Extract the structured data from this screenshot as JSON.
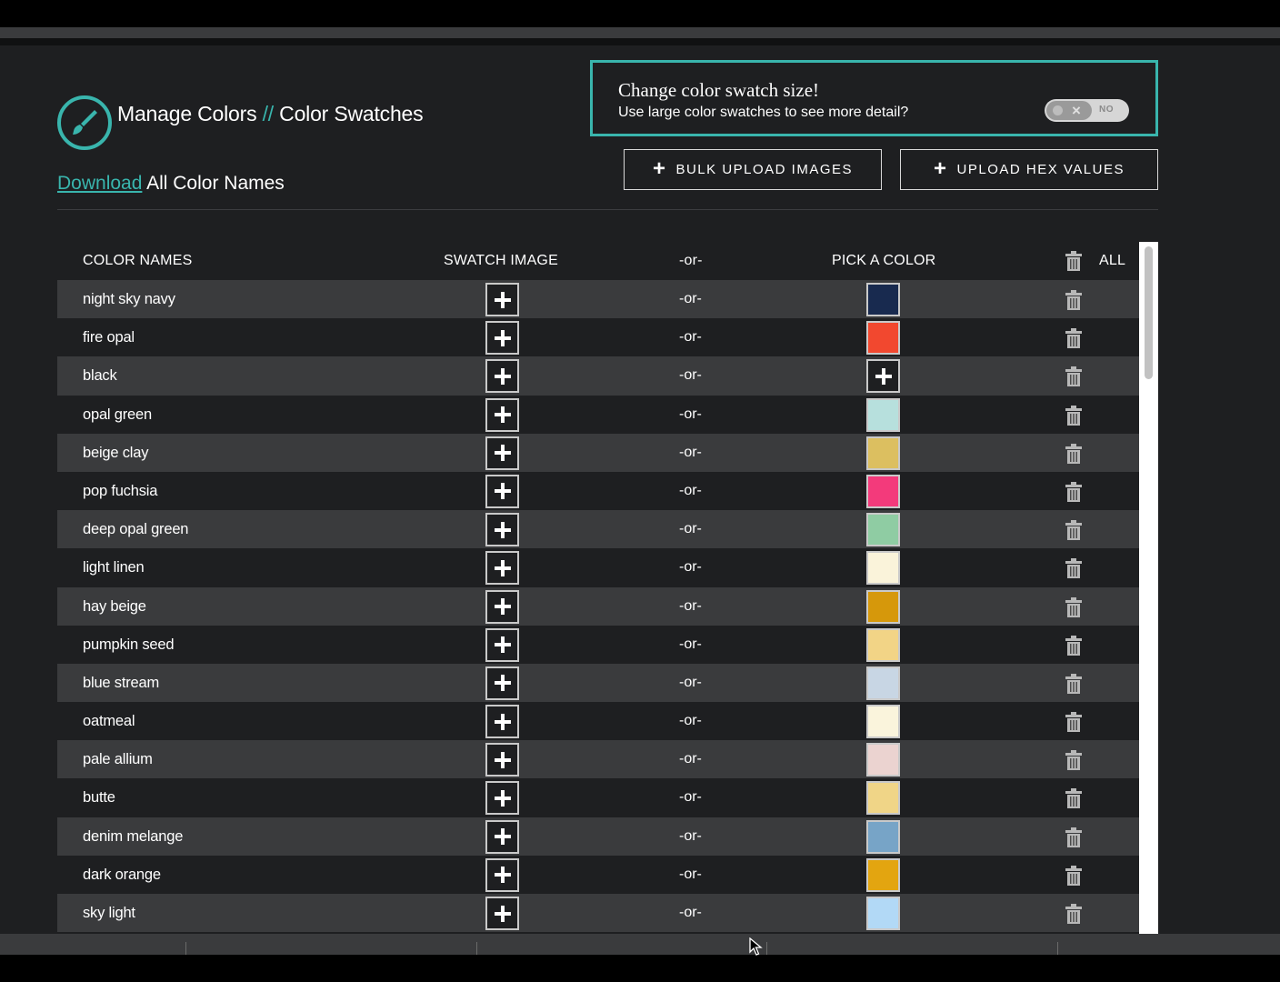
{
  "header": {
    "title_part1": "Manage Colors",
    "title_sep": "//",
    "title_part2": "Color Swatches",
    "download_link": "Download",
    "download_suffix": "All Color Names",
    "icon": "paintbrush-icon"
  },
  "size_panel": {
    "heading": "Change color swatch size!",
    "description": "Use large color swatches to see more detail?",
    "toggle_label": "NO",
    "toggle_on": false
  },
  "actions": {
    "bulk_upload": "BULK UPLOAD IMAGES",
    "upload_hex": "UPLOAD HEX VALUES"
  },
  "table": {
    "headers": {
      "color_names": "COLOR NAMES",
      "swatch_image": "SWATCH IMAGE",
      "or": "-or-",
      "pick_a_color": "PICK A COLOR",
      "all": "ALL"
    },
    "or_text": "-or-",
    "rows": [
      {
        "name": "night sky navy",
        "color": "#182a4f"
      },
      {
        "name": "fire opal",
        "color": "#f2482f"
      },
      {
        "name": "black",
        "color": null
      },
      {
        "name": "opal green",
        "color": "#b7e0dd"
      },
      {
        "name": "beige clay",
        "color": "#dcbf60"
      },
      {
        "name": "pop fuchsia",
        "color": "#f33a7b"
      },
      {
        "name": "deep opal green",
        "color": "#8fcca3"
      },
      {
        "name": "light linen",
        "color": "#faf3da"
      },
      {
        "name": "hay beige",
        "color": "#d6980b"
      },
      {
        "name": "pumpkin seed",
        "color": "#f2d486"
      },
      {
        "name": "blue stream",
        "color": "#c8d6e4"
      },
      {
        "name": "oatmeal",
        "color": "#faf4dc"
      },
      {
        "name": "pale allium",
        "color": "#ebd3d0"
      },
      {
        "name": "butte",
        "color": "#f0d587"
      },
      {
        "name": "denim melange",
        "color": "#77a4c7"
      },
      {
        "name": "dark orange",
        "color": "#e3a510"
      },
      {
        "name": "sky light",
        "color": "#b2d9f6"
      }
    ]
  },
  "colors": {
    "accent": "#39b5ad",
    "background": "#1e1f21",
    "row_alt": "#3a3b3d"
  }
}
